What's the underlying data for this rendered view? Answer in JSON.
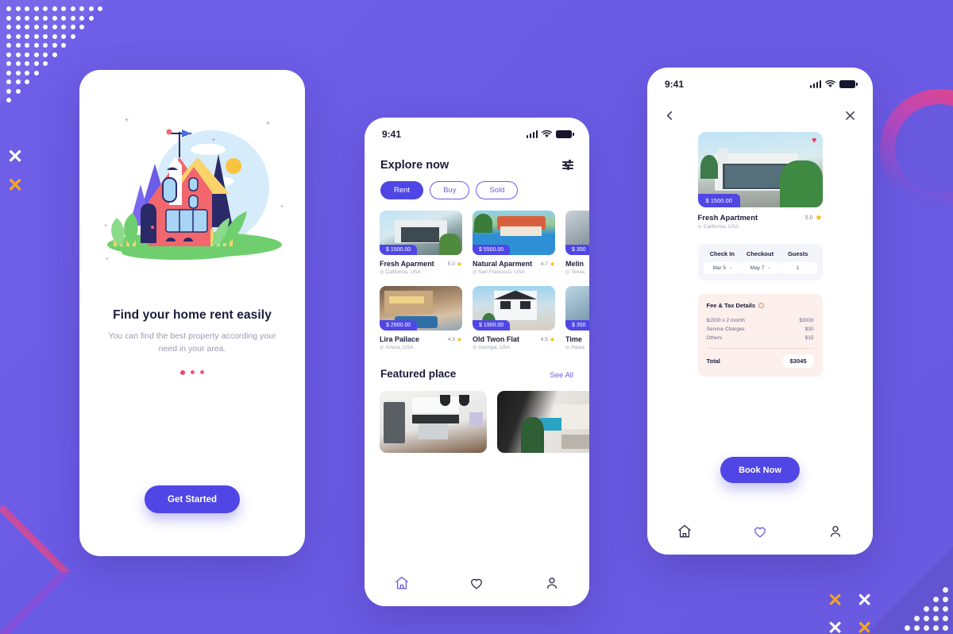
{
  "colors": {
    "background": "#6B5BE6",
    "primary": "#4F46E5",
    "accent_pink": "#F14668",
    "star": "#FFB300",
    "fee_box": "#FCEFEC",
    "stay_box": "#F4F4FB",
    "x_orange": "#F5A623",
    "x_white": "#FFFFFF"
  },
  "onboarding": {
    "title": "Find your home rent easily",
    "subtitle": "You can find the best property according your need in your area.",
    "cta_label": "Get Started",
    "pagination_dots": 3,
    "illustration_name": "house-illustration"
  },
  "explore": {
    "status_bar": {
      "time": "9:41"
    },
    "title": "Explore now",
    "filter_icon": "filter-icon",
    "chips": [
      {
        "label": "Rent",
        "active": true
      },
      {
        "label": "Buy",
        "active": false
      },
      {
        "label": "Sold",
        "active": false
      }
    ],
    "properties_row1": [
      {
        "name": "Fresh Aparment",
        "price": "$ 1500.00",
        "rating": "5.0",
        "location": "California, USA"
      },
      {
        "name": "Natural Aparment",
        "price": "$ 5500.00",
        "rating": "4.7",
        "location": "San Francisco, USA"
      },
      {
        "name": "Melin",
        "price": "$ 350",
        "rating": "",
        "location": "Texas"
      }
    ],
    "properties_row2": [
      {
        "name": "Lira Pallace",
        "price": "$ 2900.00",
        "rating": "4.3",
        "location": "Amica, USA"
      },
      {
        "name": "Old Twon Flat",
        "price": "$ 1900.00",
        "rating": "4.5",
        "location": "Georgia, USA"
      },
      {
        "name": "Time",
        "price": "$ 350",
        "rating": "",
        "location": "Hawa"
      }
    ],
    "featured": {
      "title": "Featured place",
      "see_all_label": "See All",
      "items": [
        {
          "name": "kitchen-interior"
        },
        {
          "name": "living-room-interior"
        }
      ]
    },
    "bottom_nav": [
      {
        "name": "home-icon",
        "active": true
      },
      {
        "name": "heart-icon",
        "active": false
      },
      {
        "name": "profile-icon",
        "active": false
      }
    ]
  },
  "detail": {
    "status_bar": {
      "time": "9:41"
    },
    "back_icon": "chevron-left-icon",
    "close_icon": "close-icon",
    "favorite_icon": "heart-filled-icon",
    "property": {
      "price": "$ 1500.00",
      "name": "Fresh Apartment",
      "rating": "5.0",
      "location": "California, USA"
    },
    "stay": [
      {
        "label": "Check In",
        "value": "Mar 5",
        "has_chevron": true
      },
      {
        "label": "Checkout",
        "value": "May 7",
        "has_chevron": true
      },
      {
        "label": "Guests",
        "value": "1",
        "has_chevron": false
      }
    ],
    "fees": {
      "title": "Fee & Tax Details",
      "info_icon": "info-icon",
      "rows": [
        {
          "label": "$1500 x 2 month",
          "value": "$3000"
        },
        {
          "label": "Service Charges",
          "value": "$30"
        },
        {
          "label": "Others",
          "value": "$15"
        }
      ],
      "total_label": "Total",
      "total_value": "$3045"
    },
    "book_label": "Book Now",
    "bottom_nav": [
      {
        "name": "home-icon",
        "active": false
      },
      {
        "name": "heart-icon",
        "active": true
      },
      {
        "name": "profile-icon",
        "active": false
      }
    ]
  },
  "decor": {
    "dot_triangle": "dot-triangle-pattern",
    "x_marks_left": [
      "white",
      "orange"
    ],
    "x_marks_bottom_right": [
      "orange",
      "white",
      "white",
      "orange"
    ],
    "ring": "gradient-ring",
    "triangle": "gradient-triangle"
  }
}
